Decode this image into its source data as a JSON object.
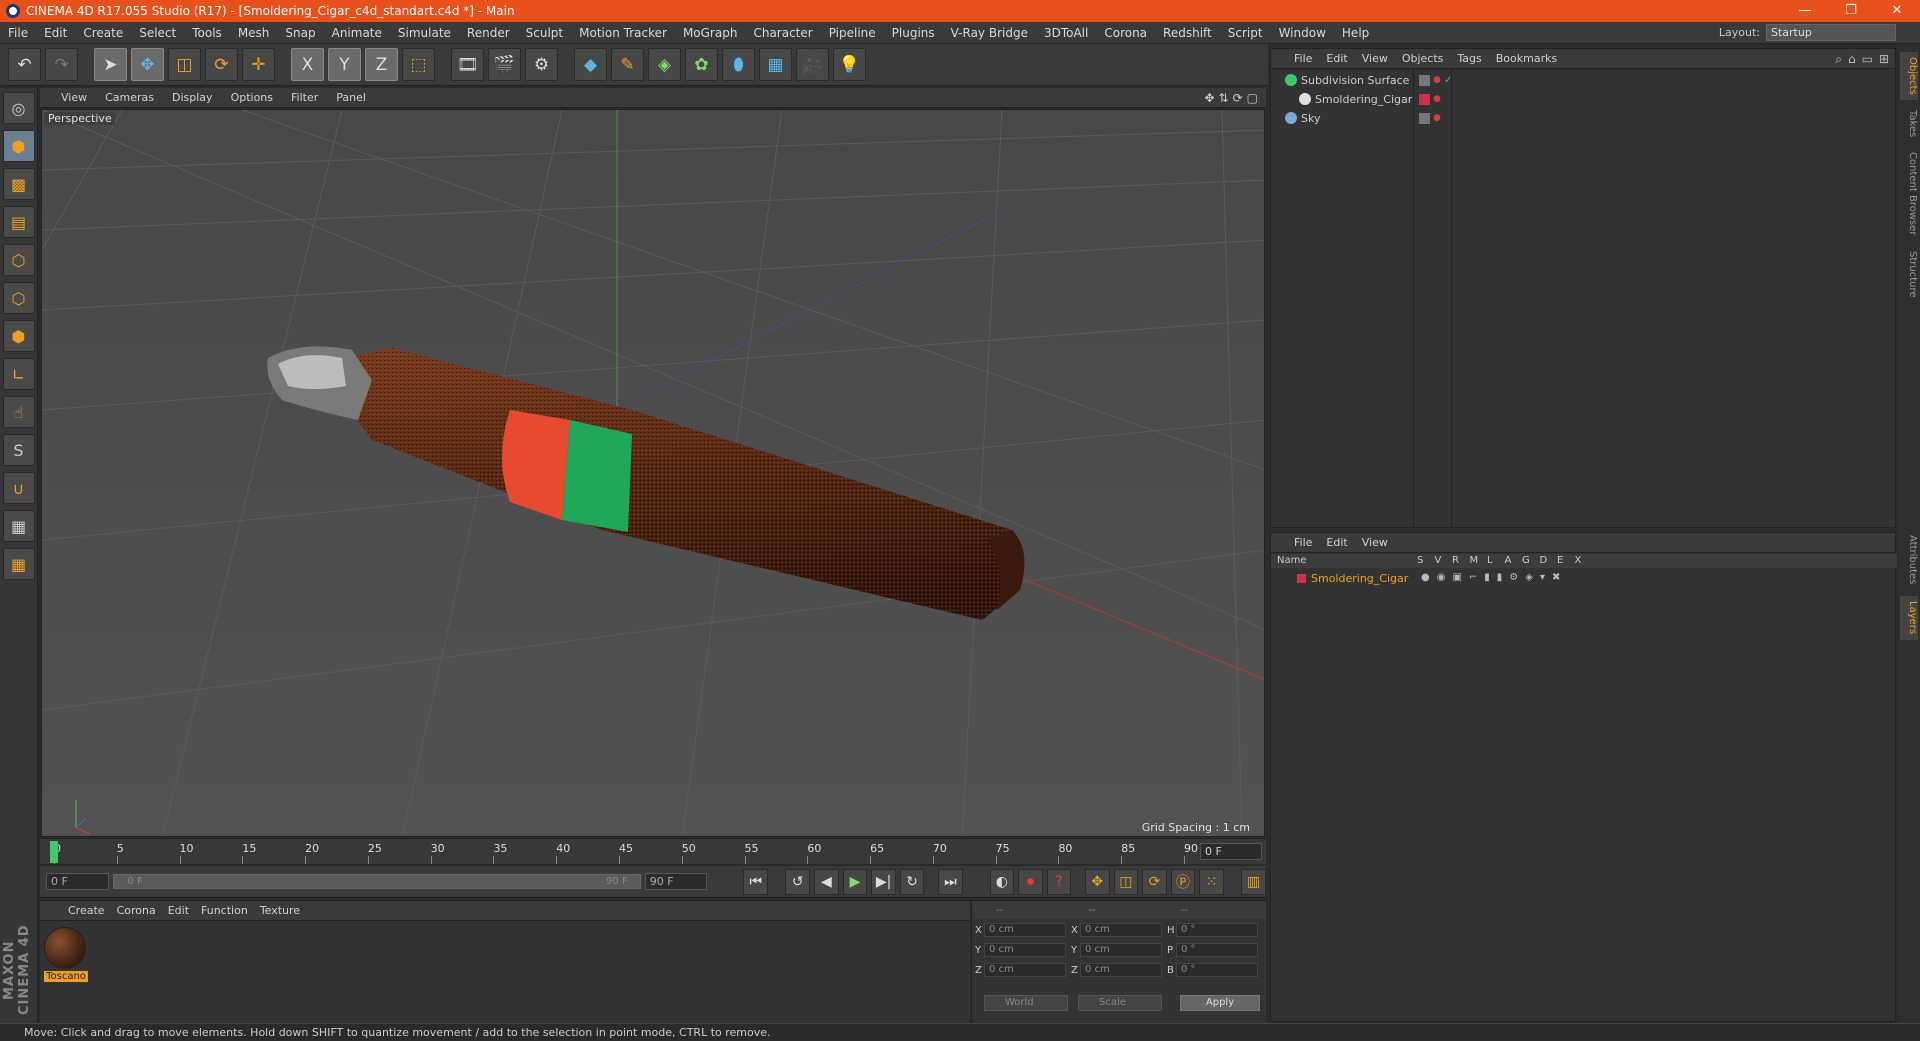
{
  "window": {
    "title": "CINEMA 4D R17.055 Studio (R17) - [Smoldering_Cigar_c4d_standart.c4d *] - Main",
    "controls": [
      "—",
      "❐",
      "✕"
    ]
  },
  "menubar": {
    "items": [
      "File",
      "Edit",
      "Create",
      "Select",
      "Tools",
      "Mesh",
      "Snap",
      "Animate",
      "Simulate",
      "Render",
      "Sculpt",
      "Motion Tracker",
      "MoGraph",
      "Character",
      "Pipeline",
      "Plugins",
      "V-Ray Bridge",
      "3DToAll",
      "Corona",
      "Redshift",
      "Script",
      "Window",
      "Help"
    ],
    "layout_label": "Layout:",
    "layout_value": "Startup"
  },
  "toolbar": {
    "icons": [
      "undo-icon",
      "redo-icon",
      "select-arrow-icon",
      "move-icon",
      "scale-icon",
      "rotate-icon",
      "live-move-icon",
      "x-axis-icon",
      "y-axis-icon",
      "z-axis-icon",
      "coordinate-system-icon",
      "render-view-icon",
      "render-picture-viewer-icon",
      "edit-render-settings-icon",
      "cube-icon",
      "pen-spline-icon",
      "subdivision-icon",
      "array-icon",
      "deformer-icon",
      "floor-icon",
      "camera-icon",
      "light-icon"
    ],
    "axis_labels": [
      "X",
      "Y",
      "Z"
    ]
  },
  "lefttools": {
    "icons": [
      "make-editable-icon",
      "model-mode-icon",
      "texture-mode-icon",
      "workplane-icon",
      "points-mode-icon",
      "edges-mode-icon",
      "polygons-mode-icon",
      "axis-mode-icon",
      "tweak-mode-icon",
      "solo-icon",
      "snap-icon",
      "workplane-lock-icon",
      "locked-workplane-icon"
    ],
    "solo_label": "S",
    "brand": "MAXON CINEMA 4D"
  },
  "viewport": {
    "menu": [
      "View",
      "Cameras",
      "Display",
      "Options",
      "Filter",
      "Panel"
    ],
    "nav_icons": [
      "✥",
      "⇅",
      "⟳",
      "▢"
    ],
    "label": "Perspective",
    "grid_spacing": "Grid Spacing : 1 cm"
  },
  "timeline": {
    "ticks": [
      "0",
      "5",
      "10",
      "15",
      "20",
      "25",
      "30",
      "35",
      "40",
      "45",
      "50",
      "55",
      "60",
      "65",
      "70",
      "75",
      "80",
      "85",
      "90"
    ],
    "current_frame": "0 F",
    "start_field": "0 F",
    "slider_start": "0 F",
    "slider_end": "90 F",
    "end_field": "90 F"
  },
  "transport": {
    "buttons": [
      "⏮",
      "↺",
      "◀",
      "▶",
      "▶|",
      "↻",
      "⏭"
    ],
    "key_buttons": [
      "key-auto-icon",
      "record-icon",
      "help-key-icon",
      "move-key-icon",
      "scale-key-icon",
      "rotate-key-icon",
      "param-key-icon",
      "pla-key-icon",
      "timeline-icon"
    ]
  },
  "materials": {
    "menu": [
      "Create",
      "Corona",
      "Edit",
      "Function",
      "Texture"
    ],
    "items": [
      {
        "name": "Toscano"
      }
    ]
  },
  "coordinates": {
    "header": [
      "--",
      "--",
      "--"
    ],
    "rows": [
      {
        "a": "X",
        "av": "0 cm",
        "b": "X",
        "bv": "0 cm",
        "c": "H",
        "cv": "0 °"
      },
      {
        "a": "Y",
        "av": "0 cm",
        "b": "Y",
        "bv": "0 cm",
        "c": "P",
        "cv": "0 °"
      },
      {
        "a": "Z",
        "av": "0 cm",
        "b": "Z",
        "bv": "0 cm",
        "c": "B",
        "cv": "0 °"
      }
    ],
    "space": "World",
    "mode": "Scale",
    "apply": "Apply"
  },
  "objects": {
    "menu": [
      "File",
      "Edit",
      "View",
      "Objects",
      "Tags",
      "Bookmarks"
    ],
    "tree": [
      {
        "name": "Subdivision Surface",
        "icon_color": "#3ec96a",
        "indent": 0
      },
      {
        "name": "Smoldering_Cigar",
        "icon_color": "#e0e0e0",
        "indent": 1
      },
      {
        "name": "Sky",
        "icon_color": "#7aa8d8",
        "indent": 0
      }
    ]
  },
  "layers": {
    "menu": [
      "File",
      "Edit",
      "View"
    ],
    "columns": [
      "Name",
      "S",
      "V",
      "R",
      "M",
      "L",
      "A",
      "G",
      "D",
      "E",
      "X"
    ],
    "rows": [
      {
        "name": "Smoldering_Cigar",
        "color": "#d0304a"
      }
    ]
  },
  "right_tabs": [
    "Objects",
    "Takes",
    "Content Browser",
    "Structure",
    "Attributes",
    "Layers"
  ],
  "status": {
    "text": "Move: Click and drag to move elements. Hold down SHIFT to quantize movement / add to the selection in point mode, CTRL to remove."
  },
  "colors": {
    "accent": "#f0a020",
    "title_bg": "#e8501c",
    "band_red": "#e84a30",
    "band_green": "#1fa85a",
    "cigar_brown": "#5a2d18"
  }
}
